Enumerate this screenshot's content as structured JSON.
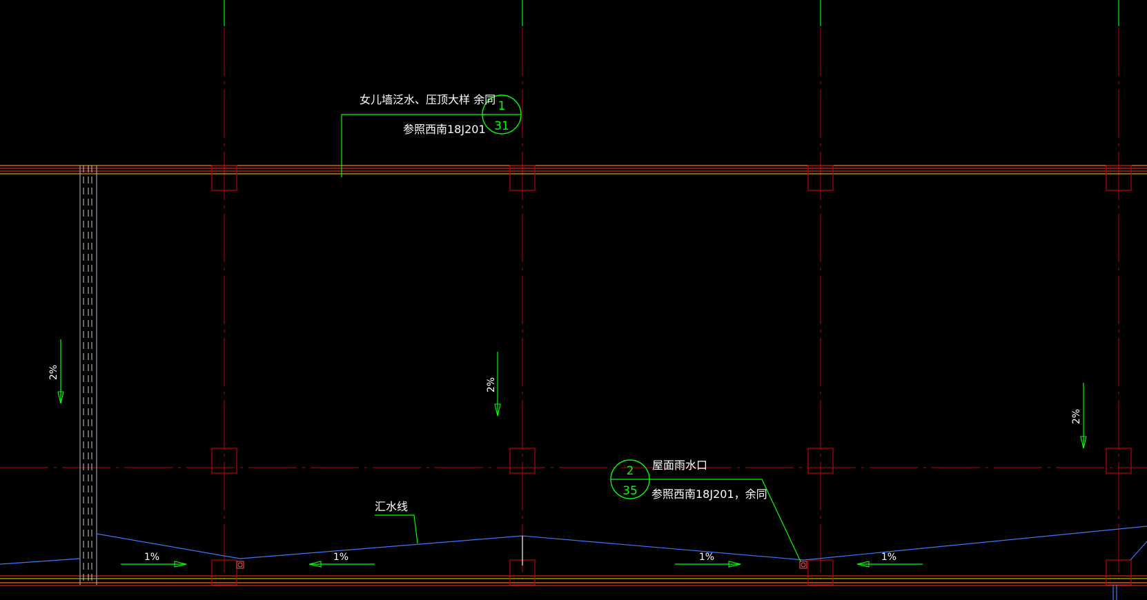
{
  "annotations": {
    "detail1": {
      "title": "女儿墙泛水、压顶大样 余同",
      "ref": "参照西南18J201",
      "num": "1",
      "sheet": "31"
    },
    "detail2": {
      "title": "屋面雨水口",
      "ref": "参照西南18J201，余同",
      "num": "2",
      "sheet": "35"
    },
    "valley": "汇水线"
  },
  "slopes": {
    "vertical": [
      "2%",
      "2%",
      "2%"
    ],
    "horizontal": [
      "1%",
      "1%",
      "1%",
      "1%"
    ]
  },
  "colors": {
    "background": "#000000",
    "axis": "#ff0000",
    "leader": "#00ff00",
    "valley_line": "#3a78ff",
    "parapet": "#ff7a00",
    "yellow": "#ffff00"
  }
}
